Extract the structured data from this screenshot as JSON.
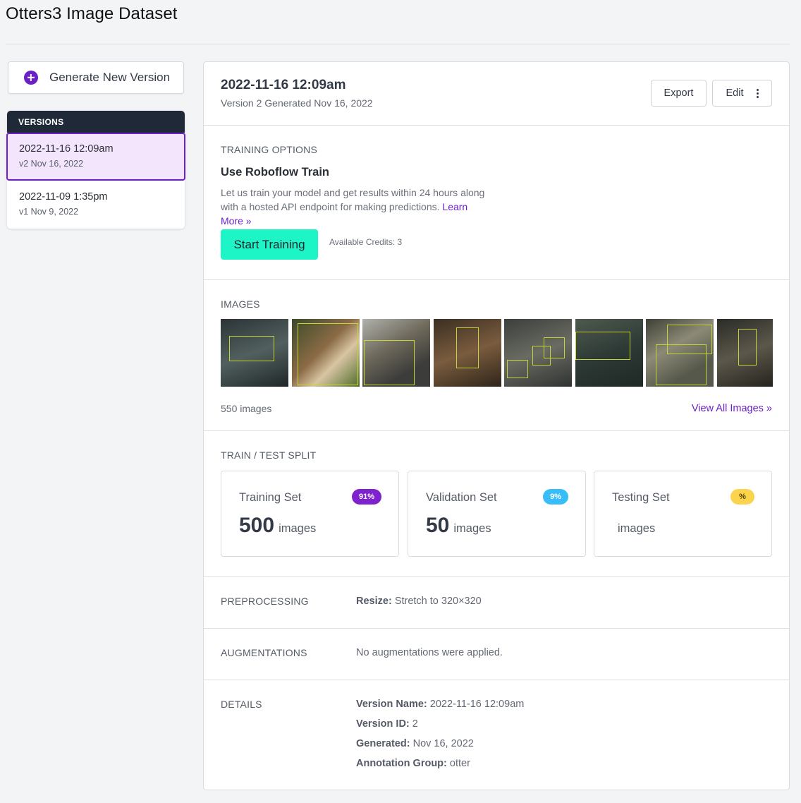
{
  "page": {
    "title": "Otters3 Image Dataset"
  },
  "sidebar": {
    "generate_label": "Generate New Version",
    "versions_header": "VERSIONS",
    "versions": [
      {
        "name": "2022-11-16 12:09am",
        "sub": "v2 Nov 16, 2022",
        "active": true
      },
      {
        "name": "2022-11-09 1:35pm",
        "sub": "v1 Nov 9, 2022",
        "active": false
      }
    ]
  },
  "header": {
    "title": "2022-11-16 12:09am",
    "subtitle": "Version 2 Generated Nov 16, 2022",
    "export_label": "Export",
    "edit_label": "Edit"
  },
  "training": {
    "section_label": "TRAINING OPTIONS",
    "title": "Use Roboflow Train",
    "description": "Let us train your model and get results within 24 hours along with a hosted API endpoint for making predictions.",
    "learn_more": "Learn More »",
    "start_label": "Start Training",
    "credits": "Available Credits: 3"
  },
  "images": {
    "section_label": "IMAGES",
    "count_text": "550 images",
    "view_all": "View All Images »",
    "thumbnails": [
      "otter-thumbnail",
      "otter-thumbnail",
      "otter-thumbnail",
      "otter-thumbnail",
      "otter-thumbnail",
      "otter-thumbnail",
      "otter-thumbnail",
      "otter-thumbnail"
    ]
  },
  "split": {
    "section_label": "TRAIN / TEST SPLIT",
    "cards": [
      {
        "name": "Training Set",
        "badge": "91%",
        "count": "500",
        "unit": "images",
        "badge_color": "#7e22ce",
        "badge_text_color": "#ffffff"
      },
      {
        "name": "Validation Set",
        "badge": "9%",
        "count": "50",
        "unit": "images",
        "badge_color": "#38bdf8",
        "badge_text_color": "#ffffff"
      },
      {
        "name": "Testing Set",
        "badge": "%",
        "count": "",
        "unit": "images",
        "badge_color": "#fcd34d",
        "badge_text_color": "#5b4300"
      }
    ]
  },
  "preprocessing": {
    "section_label": "PREPROCESSING",
    "key": "Resize:",
    "value": "Stretch to 320×320"
  },
  "augmentations": {
    "section_label": "AUGMENTATIONS",
    "value": "No augmentations were applied."
  },
  "details": {
    "section_label": "DETAILS",
    "rows": [
      {
        "key": "Version Name:",
        "value": "2022-11-16 12:09am"
      },
      {
        "key": "Version ID:",
        "value": "2"
      },
      {
        "key": "Generated:",
        "value": "Nov 16, 2022"
      },
      {
        "key": "Annotation Group:",
        "value": "otter"
      }
    ]
  },
  "colors": {
    "accent": "#6a1fc7",
    "start_button": "#1ef5c6",
    "sidebar_header": "#1f2937"
  }
}
